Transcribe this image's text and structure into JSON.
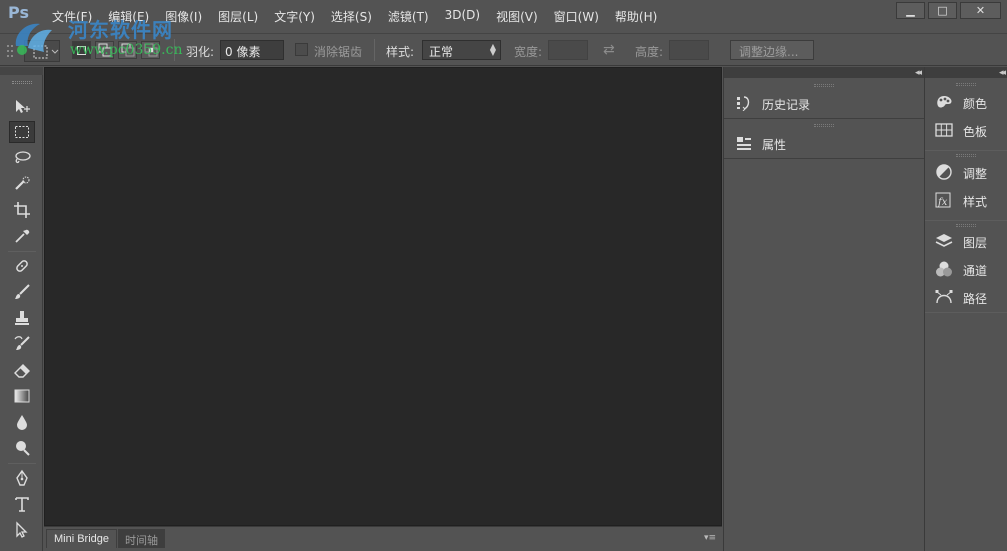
{
  "app": {
    "logo_text": "Ps",
    "watermark_title": "河东软件网",
    "watermark_url": "www.pc0359.cn"
  },
  "menu": [
    "文件(F)",
    "编辑(E)",
    "图像(I)",
    "图层(L)",
    "文字(Y)",
    "选择(S)",
    "滤镜(T)",
    "3D(D)",
    "视图(V)",
    "窗口(W)",
    "帮助(H)"
  ],
  "window_controls": {
    "minimize": "▁",
    "maximize": "□",
    "close": "✕"
  },
  "options": {
    "feather_label": "羽化:",
    "feather_value": "0 像素",
    "antialias_label": "消除锯齿",
    "style_label": "样式:",
    "style_value": "正常",
    "width_label": "宽度:",
    "height_label": "高度:",
    "refine_edge_label": "调整边缘..."
  },
  "tools": [
    "move-tool",
    "rect-marquee-tool",
    "lasso-tool",
    "quick-select-tool",
    "crop-tool",
    "eyedropper-tool",
    "healing-brush-tool",
    "brush-tool",
    "clone-stamp-tool",
    "history-brush-tool",
    "eraser-tool",
    "gradient-tool",
    "blur-tool",
    "dodge-tool",
    "pen-tool",
    "type-tool",
    "path-select-tool"
  ],
  "bottom_tabs": {
    "mini_bridge": "Mini Bridge",
    "timeline": "时间轴"
  },
  "panels_col1": [
    {
      "label": "历史记录",
      "icon": "history-icon"
    },
    {
      "label": "属性",
      "icon": "properties-icon"
    }
  ],
  "panels_col2": {
    "group1": [
      {
        "label": "颜色",
        "icon": "color-icon"
      },
      {
        "label": "色板",
        "icon": "swatches-icon"
      }
    ],
    "group2": [
      {
        "label": "调整",
        "icon": "adjustments-icon"
      },
      {
        "label": "样式",
        "icon": "styles-icon"
      }
    ],
    "group3": [
      {
        "label": "图层",
        "icon": "layers-icon"
      },
      {
        "label": "通道",
        "icon": "channels-icon"
      },
      {
        "label": "路径",
        "icon": "paths-icon"
      }
    ]
  },
  "colors": {
    "canvas": "#282828",
    "ui": "#535353",
    "dark": "#3e3e3e"
  }
}
